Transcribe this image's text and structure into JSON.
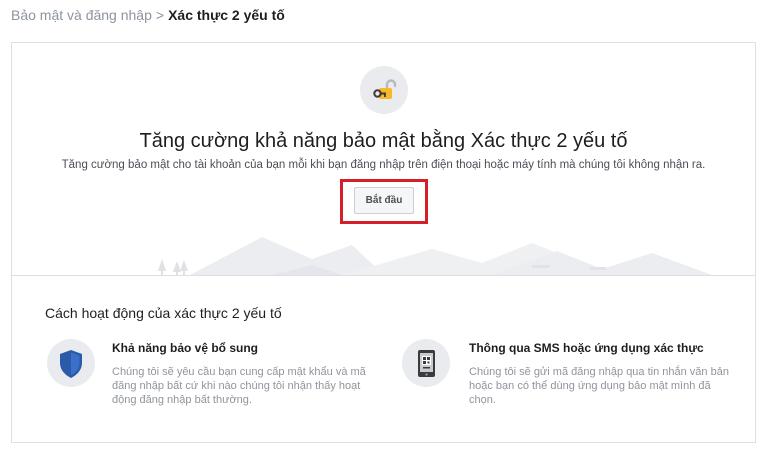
{
  "breadcrumb": {
    "parent": "Bảo mật và đăng nhập",
    "separator": ">",
    "current": "Xác thực 2 yếu tố"
  },
  "hero": {
    "icon": "unlocked-padlock-icon",
    "title": "Tăng cường khả năng bảo mật bằng Xác thực 2 yếu tố",
    "description": "Tăng cường bảo mật cho tài khoản của bạn mỗi khi bạn đăng nhập trên điện thoại hoặc máy tính mà chúng tôi không nhận ra.",
    "start_button": "Bắt đầu",
    "highlight_color": "#d41f26"
  },
  "how_it_works": {
    "title": "Cách hoạt động của xác thực 2 yếu tố",
    "features": [
      {
        "icon": "shield-icon",
        "title": "Khả năng bảo vệ bổ sung",
        "description": "Chúng tôi sẽ yêu cầu bạn cung cấp mật khẩu và mã đăng nhập bất cứ khi nào chúng tôi nhận thấy hoạt động đăng nhập bất thường."
      },
      {
        "icon": "phone-qr-icon",
        "title": "Thông qua SMS hoặc ứng dụng xác thực",
        "description": "Chúng tôi sẽ gửi mã đăng nhập qua tin nhắn văn bản hoặc bạn có thể dùng ứng dụng bảo mật mình đã chọn."
      }
    ]
  },
  "colors": {
    "text_primary": "#1c1e21",
    "text_muted": "#90949c",
    "border": "#dddfe2",
    "shield_blue": "#2b5aa8"
  }
}
